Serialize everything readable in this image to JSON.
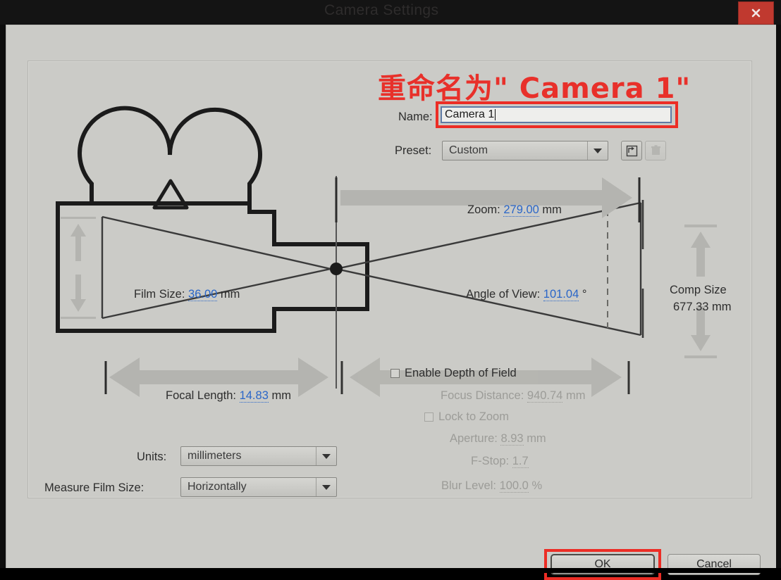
{
  "window": {
    "title": "Camera Settings",
    "close_icon": "close-icon"
  },
  "annotation": {
    "text": "重命名为\" Camera 1\"",
    "color": "#e8302a"
  },
  "form": {
    "name_label": "Name:",
    "name_value": "Camera 1",
    "preset_label": "Preset:",
    "preset_value": "Custom",
    "preset_save_icon": "save-preset-icon",
    "preset_delete_icon": "delete-preset-icon"
  },
  "diagram": {
    "zoom_label": "Zoom:",
    "zoom_value": "279.00",
    "zoom_unit": "mm",
    "film_size_label": "Film Size:",
    "film_size_value": "36.00",
    "film_size_unit": "mm",
    "angle_of_view_label": "Angle of View:",
    "angle_of_view_value": "101.04",
    "angle_of_view_unit": "°",
    "comp_size_label": "Comp Size",
    "comp_size_value": "677.33 mm",
    "focal_length_label": "Focal Length:",
    "focal_length_value": "14.83",
    "focal_length_unit": "mm",
    "focus_distance_label": "Focus Distance:",
    "focus_distance_value": "940.74",
    "focus_distance_unit": "mm"
  },
  "depth_of_field": {
    "enable_label": "Enable Depth of Field",
    "enable_checked": false,
    "lock_label": "Lock to Zoom",
    "lock_checked": false,
    "aperture_label": "Aperture:",
    "aperture_value": "8.93",
    "aperture_unit": "mm",
    "fstop_label": "F-Stop:",
    "fstop_value": "1.7",
    "blur_label": "Blur Level:",
    "blur_value": "100.0",
    "blur_unit": "%"
  },
  "options": {
    "units_label": "Units:",
    "units_value": "millimeters",
    "measure_label": "Measure Film Size:",
    "measure_value": "Horizontally"
  },
  "footer": {
    "ok_label": "OK",
    "cancel_label": "Cancel"
  },
  "colors": {
    "dialog_bg": "#cbcbc7",
    "accent_number": "#2a66c8",
    "annotation_red": "#e8302a",
    "close_red": "#c0392f"
  }
}
